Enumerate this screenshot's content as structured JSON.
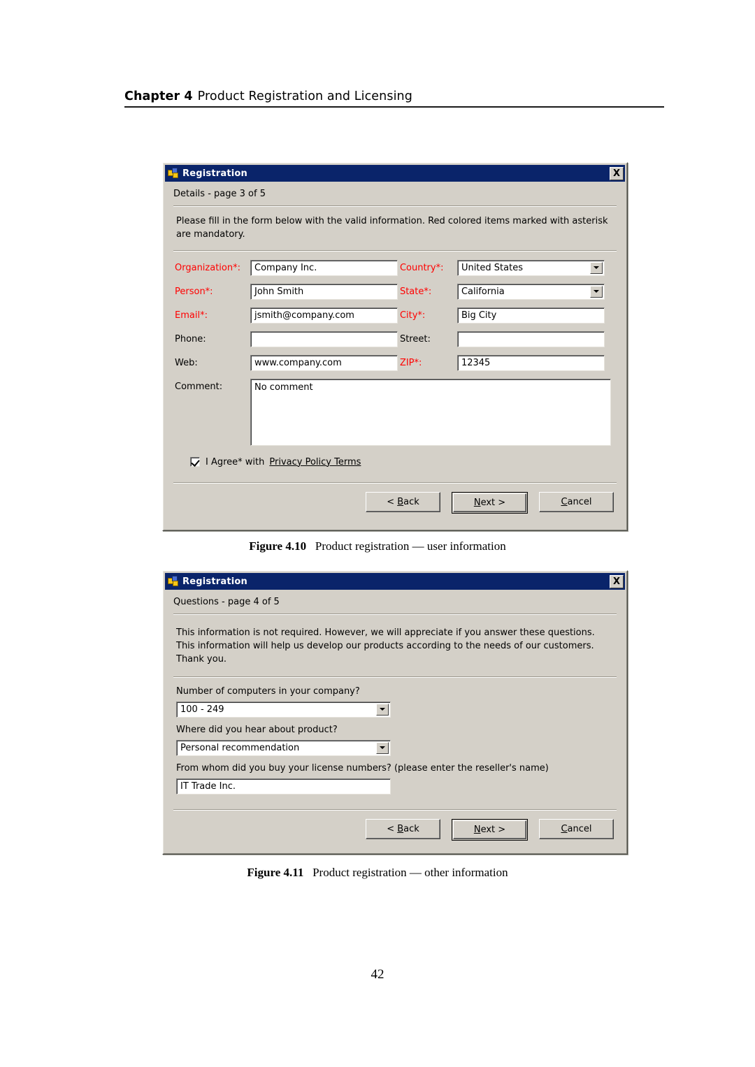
{
  "page": {
    "running_head": {
      "chapter": "Chapter 4",
      "title": "Product Registration and Licensing"
    },
    "folio": "42"
  },
  "figures": [
    {
      "number": "Figure 4.10",
      "caption": "Product registration — user information"
    },
    {
      "number": "Figure 4.11",
      "caption": "Product registration — other information"
    }
  ],
  "dialog_details": {
    "title": "Registration",
    "close_label": "X",
    "page_label": "Details - page 3 of 5",
    "intro": "Please fill in the form below with the valid information. Red colored items marked with asterisk are mandatory.",
    "fields_left": [
      {
        "label": "Organization*:",
        "required": true,
        "value": "Company Inc.",
        "type": "text"
      },
      {
        "label": "Person*:",
        "required": true,
        "value": "John Smith",
        "type": "text"
      },
      {
        "label": "Email*:",
        "required": true,
        "value": "jsmith@company.com",
        "type": "text"
      },
      {
        "label": "Phone:",
        "required": false,
        "value": "",
        "type": "text"
      },
      {
        "label": "Web:",
        "required": false,
        "value": "www.company.com",
        "type": "text"
      }
    ],
    "fields_right": [
      {
        "label": "Country*:",
        "required": true,
        "value": "United States",
        "type": "combo"
      },
      {
        "label": "State*:",
        "required": true,
        "value": "California",
        "type": "combo"
      },
      {
        "label": "City*:",
        "required": true,
        "value": "Big City",
        "type": "text"
      },
      {
        "label": "Street:",
        "required": false,
        "value": "",
        "type": "text"
      },
      {
        "label": "ZIP*:",
        "required": true,
        "value": "12345",
        "type": "text"
      }
    ],
    "comment": {
      "label": "Comment:",
      "value": "No comment"
    },
    "agree": {
      "checked": true,
      "text": "I Agree* with",
      "link": "Privacy Policy Terms"
    },
    "buttons": {
      "back": {
        "prefix": "< ",
        "accel": "B",
        "rest": "ack",
        "default": false
      },
      "next": {
        "prefix": "",
        "accel": "N",
        "rest": "ext >",
        "default": true
      },
      "cancel": {
        "prefix": "",
        "accel": "C",
        "rest": "ancel",
        "default": false
      }
    }
  },
  "dialog_questions": {
    "title": "Registration",
    "close_label": "X",
    "page_label": "Questions - page 4 of 5",
    "intro": "This information is not required. However, we will appreciate if you answer these questions. This information will help us develop our products according to the needs of our customers. Thank you.",
    "questions": [
      {
        "label": "Number of computers in your company?",
        "value": "100 - 249",
        "type": "combo"
      },
      {
        "label": "Where did you hear about product?",
        "value": "Personal recommendation",
        "type": "combo"
      },
      {
        "label": "From whom did you buy your license numbers? (please enter the reseller's name)",
        "value": "IT Trade Inc.",
        "type": "text"
      }
    ],
    "buttons": {
      "back": {
        "prefix": "< ",
        "accel": "B",
        "rest": "ack",
        "default": false
      },
      "next": {
        "prefix": "",
        "accel": "N",
        "rest": "ext >",
        "default": true
      },
      "cancel": {
        "prefix": "",
        "accel": "C",
        "rest": "ancel",
        "default": false
      }
    }
  },
  "colors": {
    "titlebar": "#0a246a",
    "dialog_face": "#d4d0c8",
    "required_label": "#ff0000"
  }
}
